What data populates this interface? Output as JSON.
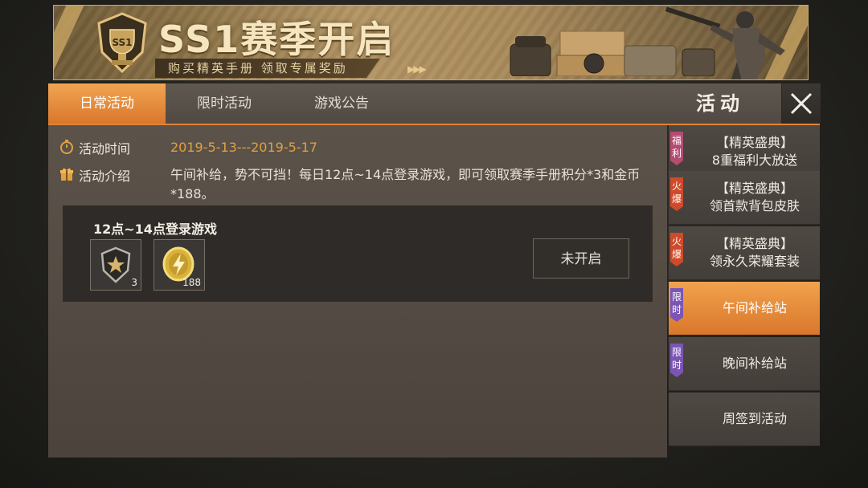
{
  "banner": {
    "title": "SS1赛季开启",
    "subtitle": "购买精英手册  领取专属奖励",
    "emblem_text": "SS1"
  },
  "tabs": [
    {
      "label": "日常活动",
      "active": true
    },
    {
      "label": "限时活动",
      "active": false
    },
    {
      "label": "游戏公告",
      "active": false
    }
  ],
  "header": {
    "title": "活动"
  },
  "activity": {
    "time_label": "活动时间",
    "time_value": "2019-5-13---2019-5-17",
    "intro_label": "活动介绍",
    "intro_value": "午间补给，势不可挡！每日12点~14点登录游戏，即可领取赛季手册积分*3和金币*188。"
  },
  "reward": {
    "title": "12点~14点登录游戏",
    "items": [
      {
        "icon": "rank-badge-icon",
        "qty": "3"
      },
      {
        "icon": "gold-coin-icon",
        "qty": "188"
      }
    ],
    "status_button": "未开启"
  },
  "sidebar": {
    "items": [
      {
        "badge": "福利",
        "badge_color": "#b44c71",
        "line1": "【精英盛典】",
        "line2": "8重福利大放送",
        "active": false
      },
      {
        "badge": "火爆",
        "badge_color": "#cf4a2a",
        "line1": "【精英盛典】",
        "line2": "领首款背包皮肤",
        "active": false
      },
      {
        "badge": "火爆",
        "badge_color": "#cf4a2a",
        "line1": "【精英盛典】",
        "line2": "领永久荣耀套装",
        "active": false
      },
      {
        "badge": "限时",
        "badge_color": "#7b55b5",
        "line1": "午间补给站",
        "line2": "",
        "active": true
      },
      {
        "badge": "限时",
        "badge_color": "#7b55b5",
        "line1": "晚间补给站",
        "line2": "",
        "active": false
      },
      {
        "badge": "",
        "badge_color": "",
        "line1": "周签到活动",
        "line2": "",
        "active": false
      }
    ]
  },
  "colors": {
    "accent": "#e0843a",
    "date": "#e1a13f",
    "gold": "#c9a96b"
  }
}
